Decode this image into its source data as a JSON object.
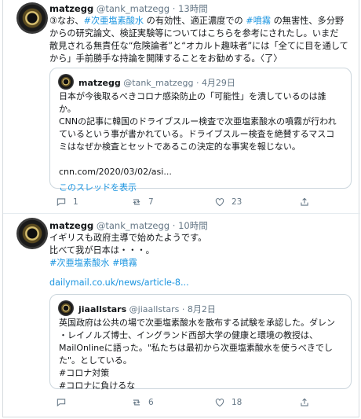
{
  "tweet1": {
    "name": "matzegg",
    "handle": "@tank_matzegg",
    "time": "13時間",
    "body": [
      [
        {
          "t": "③なお、"
        },
        {
          "t": "#次亜塩素酸水",
          "tag": true
        },
        {
          "t": " の有効性、適正濃度での "
        },
        {
          "t": "#噴霧",
          "tag": true
        },
        {
          "t": " の無害性、多分野"
        }
      ],
      [
        {
          "t": "からの研究論文、検証実験等についてはこちらを参考にされたし。いまだ"
        }
      ],
      [
        {
          "t": "散見される無責任な“危険論者”と“オカルト趣味者”には「全てに目を通して"
        }
      ],
      [
        {
          "t": "から」手前勝手な持論を開陳することをお勧めする。〈了〉"
        }
      ]
    ],
    "quote": {
      "name": "matzegg",
      "handle": "@tank_matzegg",
      "time": "4月29日",
      "lines": [
        "日本が今後取るべきコロナ感染防止の「可能性」を潰しているのは誰",
        "か。",
        "CNNの記事に韓国のドライブスルー検査で次亜塩素酸水の噴霧が行われ",
        "ているという事が書かれている。ドライブスルー検査を絶賛するマスコ",
        "ミはなぜか検査とセットであるこの決定的な事実を報じない。",
        "",
        "cnn.com/2020/03/02/asi..."
      ],
      "thread_link": "このスレッドを表示"
    },
    "actions": {
      "reply": "1",
      "retweet": "7",
      "like": "23"
    }
  },
  "tweet2": {
    "name": "matzegg",
    "handle": "@tank_matzegg",
    "time": "10時間",
    "body": [
      [
        {
          "t": "イギリスも政府主導で始めたようです。"
        }
      ],
      [
        {
          "t": "比べて我が日本は・・・。"
        }
      ],
      [
        {
          "t": "#次亜塩素酸水",
          "tag": true
        },
        {
          "t": " "
        },
        {
          "t": "#噴霧",
          "tag": true
        }
      ]
    ],
    "link": "dailymail.co.uk/news/article-8...",
    "quote": {
      "name": "jiaallstars",
      "handle": "@jiaallstars",
      "time": "8月2日",
      "lines": [
        "英国政府は公共の場で次亜塩素酸水を散布する試験を承認した。ダレン",
        "・レイノルズ博士、イングランド西部大学の健康と環境の教授は、",
        "MailOnlineに語った。\"私たちは最初から次亜塩素酸水を使うべきでし",
        "た\"。としている。",
        "#コロナ対策",
        "#コロナに負けるな"
      ]
    },
    "actions": {
      "reply": "",
      "retweet": "6",
      "like": "18"
    }
  }
}
